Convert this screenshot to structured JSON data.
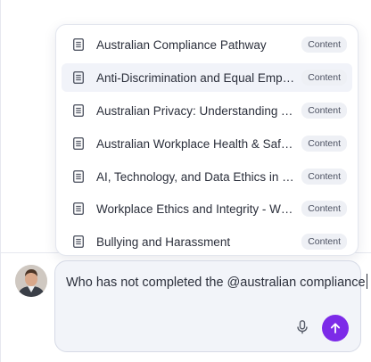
{
  "dropdown": {
    "items": [
      {
        "label": "Australian Compliance Pathway",
        "badge": "Content",
        "icon": "document-icon"
      },
      {
        "label": "Anti-Discrimination and Equal Emplo...",
        "badge": "Content",
        "icon": "document-icon"
      },
      {
        "label": "Australian Privacy: Understanding Yo...",
        "badge": "Content",
        "icon": "document-icon"
      },
      {
        "label": "Australian Workplace Health & Safety",
        "badge": "Content",
        "icon": "document-icon"
      },
      {
        "label": "AI, Technology, and Data Ethics in the ...",
        "badge": "Content",
        "icon": "document-icon"
      },
      {
        "label": "Workplace Ethics and Integrity - Whi...",
        "badge": "Content",
        "icon": "document-icon"
      },
      {
        "label": "Bullying and Harassment",
        "badge": "Content",
        "icon": "document-icon"
      }
    ],
    "active_index": 1
  },
  "composer": {
    "value": "Who has not completed the @australian compliance",
    "mic_icon": "microphone-icon",
    "send_icon": "arrow-up-icon"
  },
  "colors": {
    "accent": "#7c2ae8",
    "composer_bg": "#f2f4f9",
    "badge_bg": "#eef0f5",
    "active_row_bg": "#f1f3f9"
  }
}
